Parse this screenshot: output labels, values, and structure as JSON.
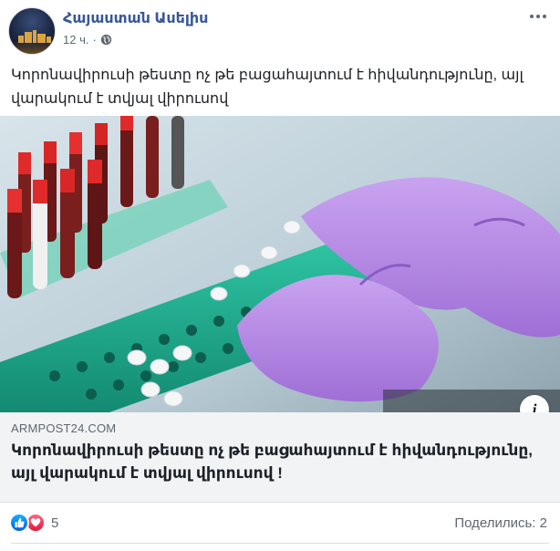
{
  "header": {
    "page_name": "Հայաստան Ասելիս",
    "time": "12 ч.",
    "separator": "·",
    "privacy_icon": "globe-icon",
    "more_icon": "more-options-icon"
  },
  "post": {
    "text": "Կորոնավիրուսի թեստը ոչ թե բացահայտում է հիվանդությունը, այլ վարակում է տվյալ վիրուսով"
  },
  "link_preview": {
    "image_description_icon": "info-icon",
    "domain": "ARMPOST24.COM",
    "title": "Կորոնավիրուսի թեստը ոչ թե բացահայտում է հիվանդությունը, այլ վարակում է տվյալ վիրուսով !"
  },
  "footer": {
    "reaction_icons": [
      "like-icon",
      "love-icon"
    ],
    "reaction_count": "5",
    "shares": "Поделились: 2"
  },
  "colors": {
    "page_name": "#385898",
    "secondary_text": "#606770",
    "preview_bg": "#f2f3f5",
    "like": "#1877f2",
    "love": "#f33e58",
    "glove": "#b98be6",
    "tray": "#1fa58a"
  }
}
